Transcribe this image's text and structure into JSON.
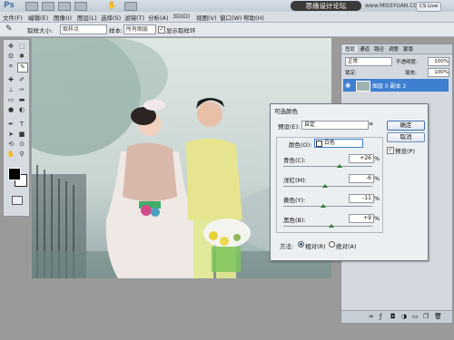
{
  "app": {
    "logo": "Ps",
    "cs_live": "CS Live"
  },
  "watermark": {
    "cn": "思缘设计论坛",
    "url": "www.MISSYUAN.COM"
  },
  "menu": [
    "文件(F)",
    "编辑(E)",
    "图像(I)",
    "图层(L)",
    "选择(S)",
    "滤镜(T)",
    "分析(A)",
    "3D(D)",
    "视图(V)",
    "窗口(W)",
    "帮助(H)"
  ],
  "options": {
    "sample_size_label": "取样大小:",
    "sample_size_value": "取样点",
    "sample_label": "样本:",
    "sample_value": "所有图层",
    "show_ring_label": "显示取样环"
  },
  "layers_panel": {
    "tabs": [
      "图层",
      "通道",
      "路径",
      "调整",
      "蒙版"
    ],
    "blend_mode": "正常",
    "opacity_label": "不透明度:",
    "opacity_value": "100%",
    "lock_label": "锁定:",
    "fill_label": "填充:",
    "fill_value": "100%",
    "layer_name": "图层 0 副本 2"
  },
  "dialog": {
    "title": "可选颜色",
    "preset_label": "预设(E):",
    "preset_value": "自定",
    "colors_label": "颜色(O):",
    "colors_value": "白色",
    "ok": "确定",
    "cancel": "取消",
    "preview": "预览(P)",
    "sliders": [
      {
        "label": "青色(C):",
        "value": "+26",
        "unit": "%",
        "level": 26
      },
      {
        "label": "洋红(M):",
        "value": "-6",
        "unit": "%",
        "level": -6
      },
      {
        "label": "黄色(Y):",
        "value": "-11",
        "unit": "%",
        "level": -11
      },
      {
        "label": "黑色(B):",
        "value": "+9",
        "unit": "%",
        "level": 9
      }
    ],
    "method_label": "方法:",
    "method_relative": "相对(R)",
    "method_absolute": "绝对(A)"
  },
  "colors": {
    "layer_highlight": "#3d7fd0",
    "slider_thumb": "#2e7d32"
  }
}
